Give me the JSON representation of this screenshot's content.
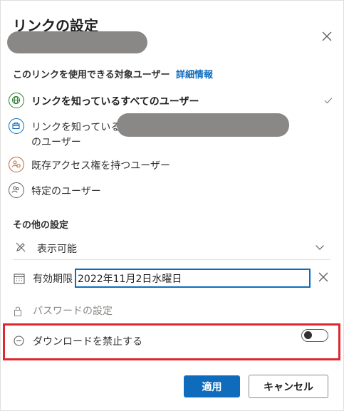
{
  "dialog": {
    "title": "リンクの設定"
  },
  "audience": {
    "heading": "このリンクを使用できる対象ユーザー",
    "details_link": "詳細情報",
    "options": [
      {
        "label": "リンクを知っているすべてのユーザー",
        "selected": true,
        "icon": "globe-icon"
      },
      {
        "label_line1": "リンクを知っている",
        "label_line2": "のユーザー",
        "selected": false,
        "icon": "briefcase-icon"
      },
      {
        "label": "既存アクセス権を持つユーザー",
        "selected": false,
        "icon": "people-lock-icon"
      },
      {
        "label": "特定のユーザー",
        "selected": false,
        "icon": "people-icon"
      }
    ]
  },
  "other_settings": {
    "heading": "その他の設定",
    "permission": "表示可能",
    "expiry_label": "有効期限",
    "expiry_value": "2022年11月2日水曜日",
    "password_label": "パスワードの設定",
    "block_download_label": "ダウンロードを禁止する",
    "block_download_on": false
  },
  "footer": {
    "apply": "適用",
    "cancel": "キャンセル"
  },
  "colors": {
    "accent": "#0f6cbd",
    "highlight": "#e0262f",
    "redaction": "#8a8886"
  }
}
